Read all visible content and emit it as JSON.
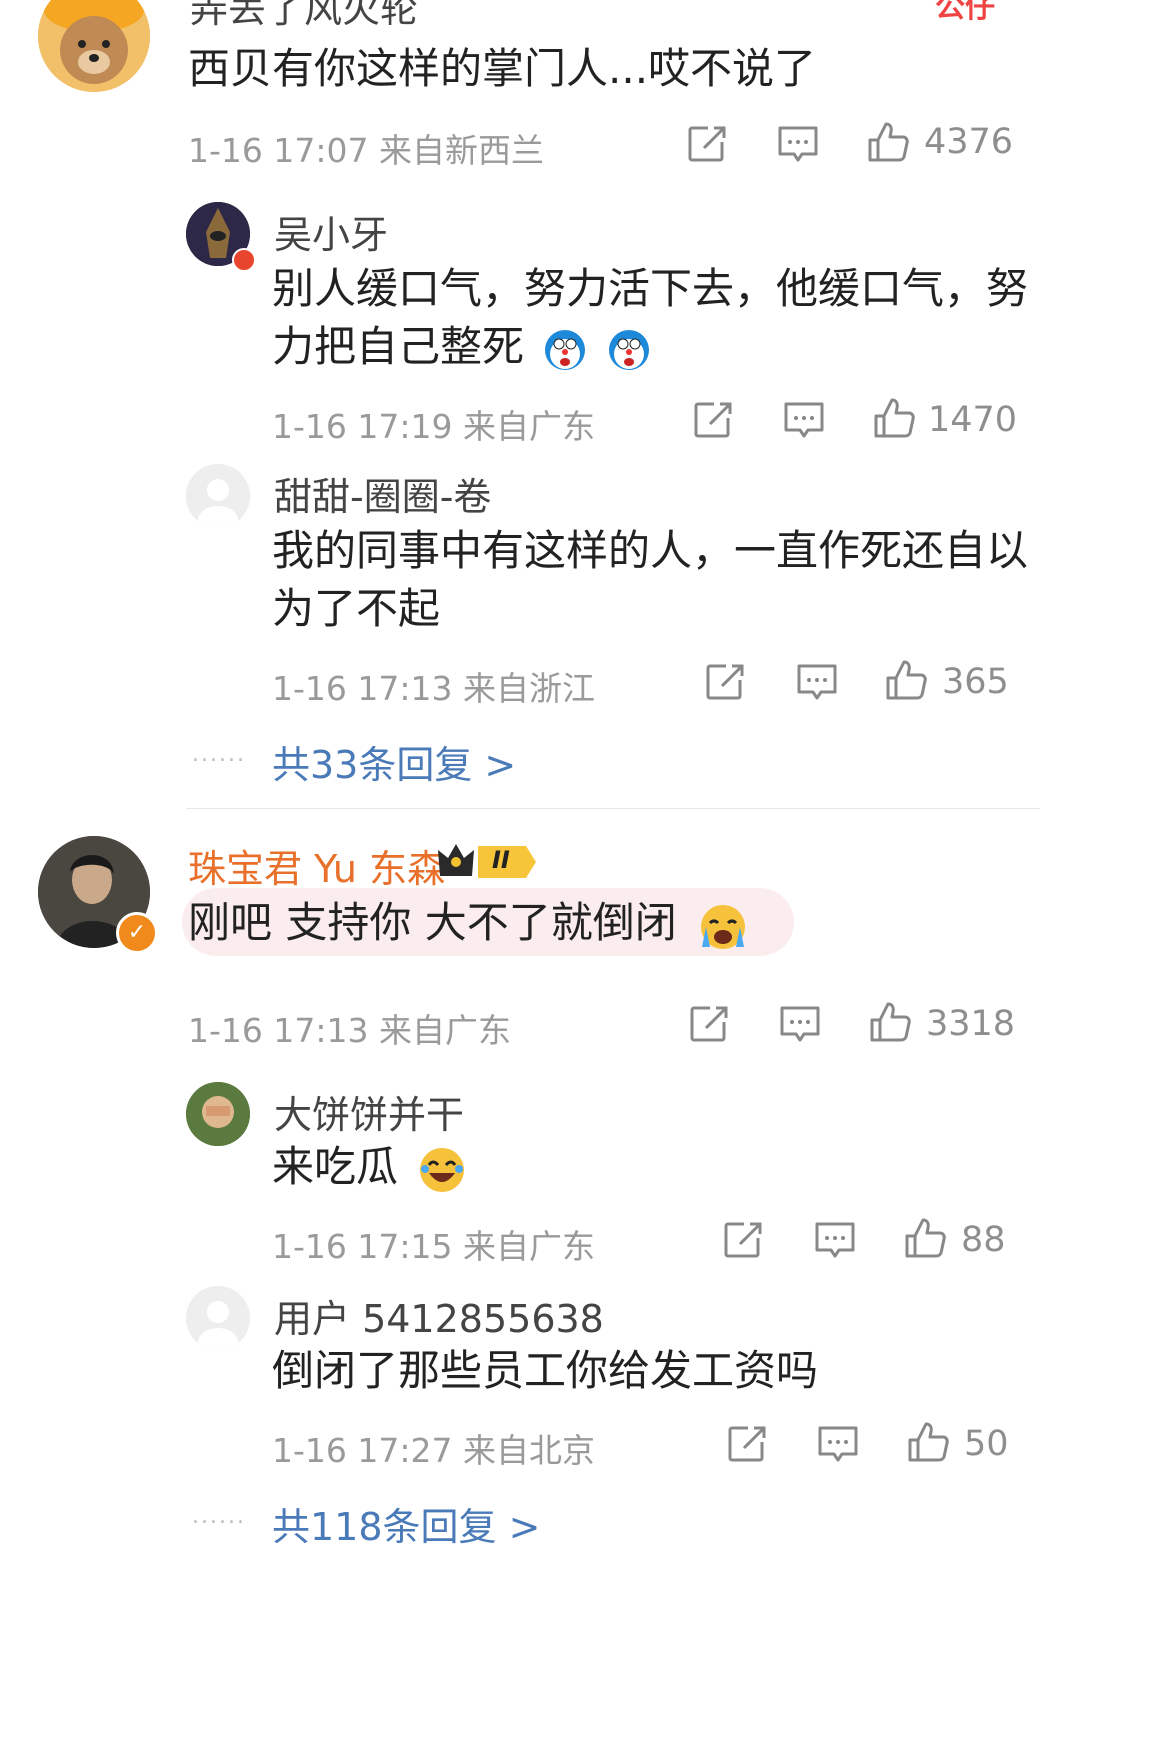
{
  "comments": [
    {
      "name": "弄丢了风火轮",
      "badge": "公仔",
      "text": "西贝有你这样的掌门人...哎不说了",
      "time": "1-16 17:07 来自新西兰",
      "likes": "4376",
      "replies": [
        {
          "name": "吴小牙",
          "text_line1": "别人缓口气，努力活下去，他缓口气，努",
          "text_line2": "力把自己整死",
          "time": "1-16 17:19 来自广东",
          "likes": "1470"
        },
        {
          "name": "甜甜-圈圈-卷",
          "text_line1": "我的同事中有这样的人，一直作死还自以",
          "text_line2": "为了不起",
          "time": "1-16 17:13 来自浙江",
          "likes": "365"
        }
      ],
      "more": "共33条回复 >",
      "dots": "......"
    },
    {
      "name": "珠宝君 Yu 东森",
      "level": "II",
      "text": "刚吧 支持你  大不了就倒闭",
      "time": "1-16 17:13 来自广东",
      "likes": "3318",
      "replies": [
        {
          "name": "大饼饼并干",
          "text": "来吃瓜",
          "time": "1-16 17:15 来自广东",
          "likes": "88"
        },
        {
          "name": "用户 5412855638",
          "text": "倒闭了那些员工你给发工资吗",
          "time": "1-16 17:27 来自北京",
          "likes": "50"
        }
      ],
      "more": "共118条回复 >",
      "dots": "......"
    }
  ],
  "colors": {
    "link": "#4a7ab8",
    "vip_name": "#e8702a",
    "meta": "#9a9a9a",
    "highlight_bg": "#fbecee"
  },
  "icons": [
    "share-icon",
    "comment-icon",
    "like-icon",
    "verified-icon",
    "crown-icon",
    "emoji-doraemon",
    "emoji-crying",
    "emoji-laughing"
  ]
}
